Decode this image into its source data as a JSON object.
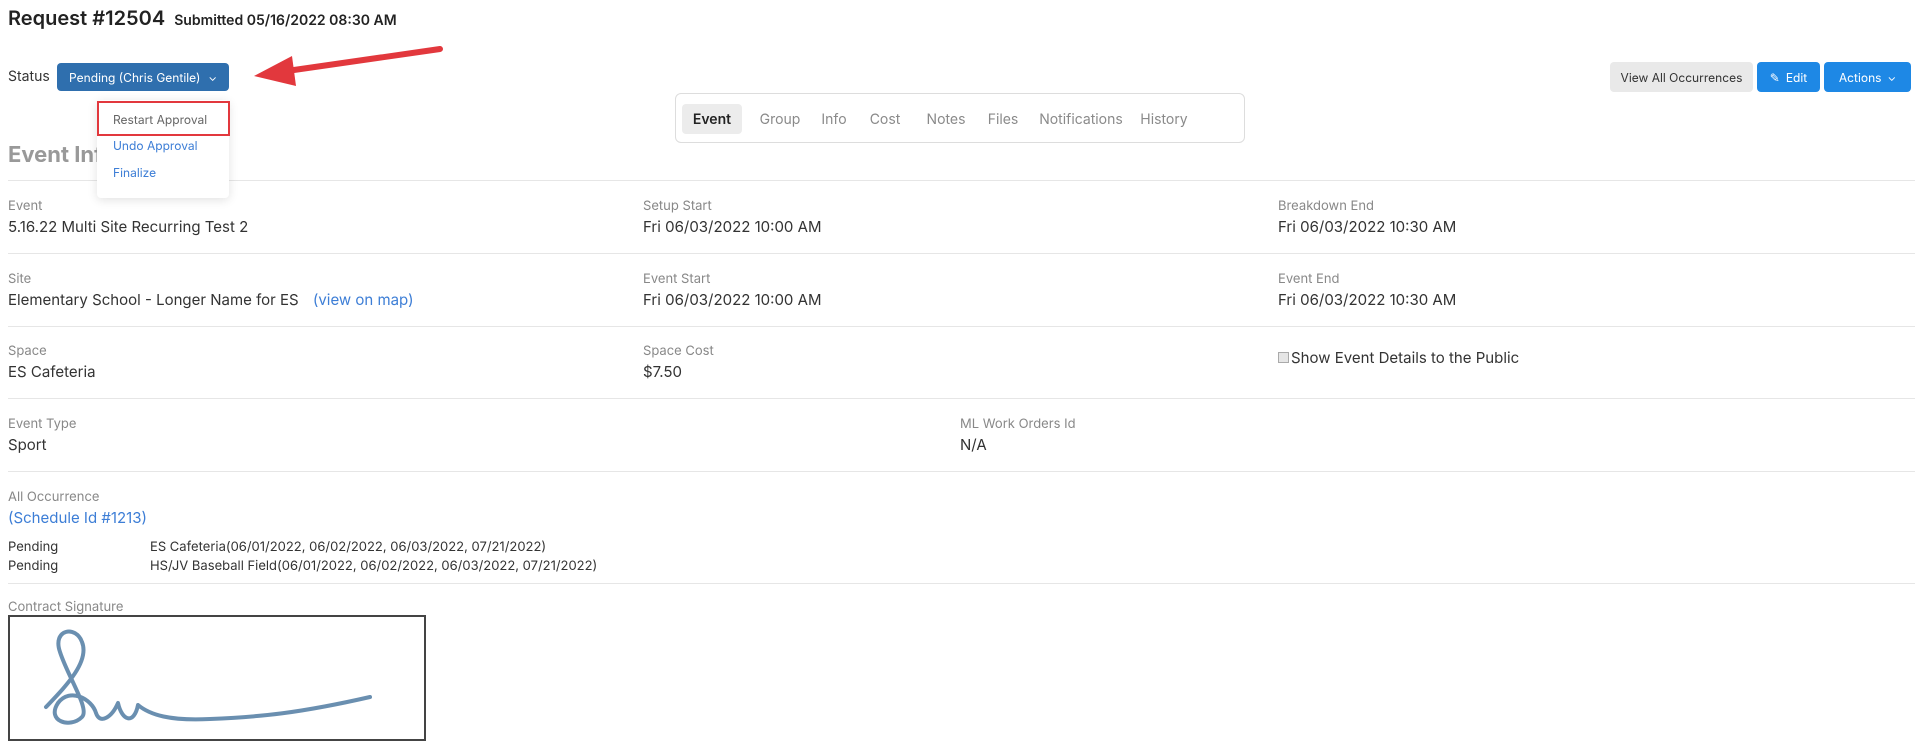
{
  "header": {
    "title": "Request #12504",
    "submitted": "Submitted 05/16/2022 08:30 AM"
  },
  "status": {
    "label": "Status",
    "button_label": "Pending (Chris Gentile)",
    "menu": [
      "Restart Approval",
      "Undo Approval",
      "Finalize"
    ]
  },
  "toolbar": {
    "view_all": "View All Occurrences",
    "edit": "Edit",
    "actions": "Actions"
  },
  "tabs": [
    "Event",
    "Group",
    "Info",
    "Cost",
    "Notes",
    "Files",
    "Notifications",
    "History"
  ],
  "section_title": "Event Info",
  "fields": {
    "event": {
      "label": "Event",
      "value": "5.16.22 Multi Site Recurring Test 2"
    },
    "setup_start": {
      "label": "Setup Start",
      "value": "Fri 06/03/2022 10:00 AM"
    },
    "breakdown_end": {
      "label": "Breakdown End",
      "value": "Fri 06/03/2022 10:30 AM"
    },
    "site": {
      "label": "Site",
      "value": "Elementary School - Longer Name for ES",
      "link": "(view on map)"
    },
    "event_start": {
      "label": "Event Start",
      "value": "Fri 06/03/2022 10:00 AM"
    },
    "event_end": {
      "label": "Event End",
      "value": "Fri 06/03/2022 10:30 AM"
    },
    "space": {
      "label": "Space",
      "value": "ES Cafeteria"
    },
    "space_cost": {
      "label": "Space Cost",
      "value": "$7.50"
    },
    "show_public": {
      "label": "Show Event Details to the Public",
      "checked": false
    },
    "event_type": {
      "label": "Event Type",
      "value": "Sport"
    },
    "ml_work_orders": {
      "label": "ML Work Orders Id",
      "value": "N/A"
    }
  },
  "occurrences": {
    "label": "All Occurrence",
    "schedule_link": "(Schedule Id #1213)",
    "rows": [
      {
        "status": "Pending",
        "detail": "ES Cafeteria(06/01/2022, 06/02/2022, 06/03/2022, 07/21/2022)"
      },
      {
        "status": "Pending",
        "detail": "HS/JV Baseball Field(06/01/2022, 06/02/2022, 06/03/2022, 07/21/2022)"
      }
    ]
  },
  "signature": {
    "label": "Contract Signature"
  },
  "colors": {
    "status_button": "#2f6fae",
    "primary_button": "#1e88e5",
    "link": "#3d7ed6",
    "annotation": "#e2383d",
    "signature_ink": "#6a8fb0"
  }
}
